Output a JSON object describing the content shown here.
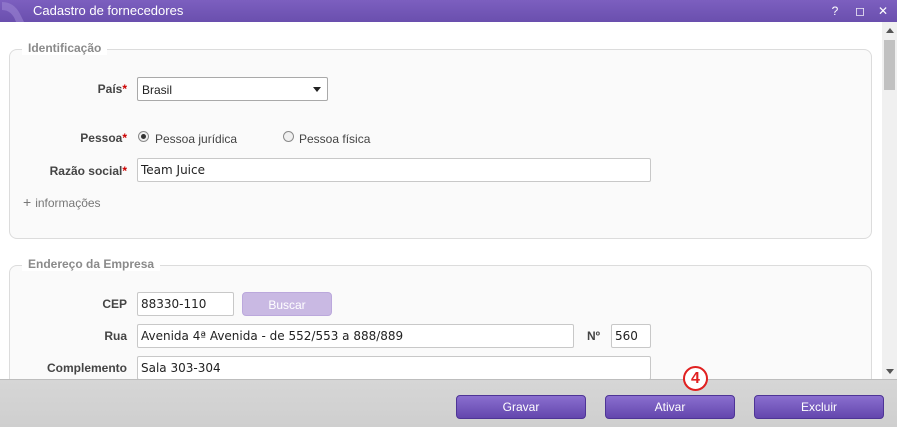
{
  "window": {
    "title": "Cadastro de fornecedores",
    "help_label": "?",
    "maximize_label": "◻",
    "close_label": "✕"
  },
  "identificacao": {
    "legend": "Identificação",
    "pais_label": "País",
    "pais_value": "Brasil",
    "pessoa_label": "Pessoa",
    "pessoa_options": [
      "Pessoa jurídica",
      "Pessoa física"
    ],
    "pessoa_selected": "Pessoa jurídica",
    "razao_label": "Razão social",
    "razao_value": "Team Juice",
    "more_label": "informações",
    "required_mark": "*"
  },
  "endereco": {
    "legend": "Endereço da Empresa",
    "cep_label": "CEP",
    "cep_value": "88330-110",
    "buscar_label": "Buscar",
    "rua_label": "Rua",
    "rua_value": "Avenida 4ª Avenida - de 552/553 a 888/889",
    "numero_label": "Nº",
    "numero_value": "560",
    "complemento_label": "Complemento",
    "complemento_value": "Sala 303-304"
  },
  "footer": {
    "gravar_label": "Gravar",
    "ativar_label": "Ativar",
    "excluir_label": "Excluir"
  },
  "annotation": {
    "step_label": "4"
  },
  "colors": {
    "accent": "#6a4fae",
    "required": "#cc0000",
    "annotation": "#e02020"
  }
}
